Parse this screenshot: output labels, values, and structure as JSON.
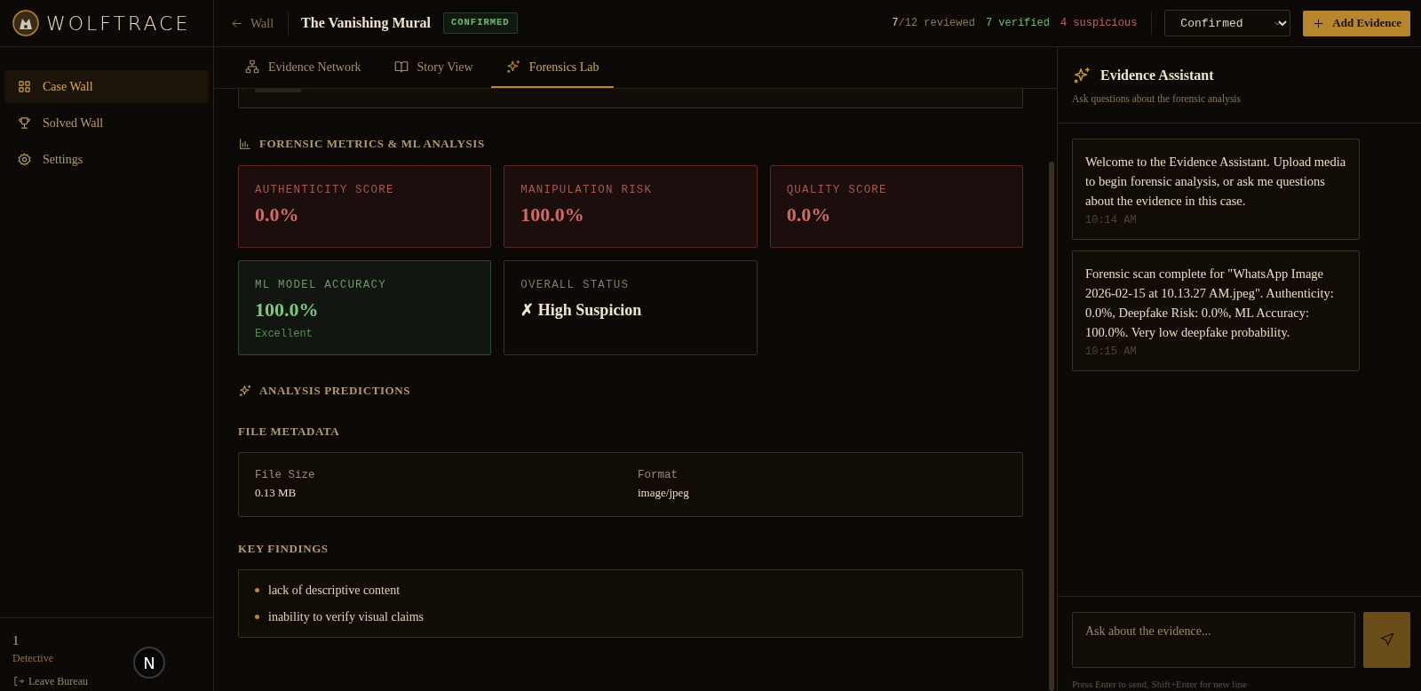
{
  "brand": {
    "name": "WOLFTRACE"
  },
  "sidebar": {
    "items": [
      {
        "label": "Case Wall",
        "selected": true
      },
      {
        "label": "Solved Wall",
        "selected": false
      },
      {
        "label": "Settings",
        "selected": false
      }
    ],
    "user": {
      "count": "1",
      "rank": "Detective",
      "logout": "Leave Bureau"
    }
  },
  "dev_badge": "N",
  "header": {
    "back": "Wall",
    "title": "The Vanishing Mural",
    "status_badge": "CONFIRMED",
    "stats": [
      {
        "kind": "progress",
        "strong": "7",
        "text": "/12 reviewed"
      },
      {
        "kind": "verified",
        "text": "7 verified"
      },
      {
        "kind": "suspicious",
        "text": "4 suspicious"
      }
    ],
    "status_select": "Confirmed",
    "add_button": "Add Evidence"
  },
  "tabs": [
    {
      "label": "Evidence Network",
      "selected": false
    },
    {
      "label": "Story View",
      "selected": false
    },
    {
      "label": "Forensics Lab",
      "selected": true
    }
  ],
  "metrics_section": {
    "title": "FORENSIC METRICS & ML ANALYSIS",
    "cards": [
      {
        "kind": "alert",
        "label": "AUTHENTICITY SCORE",
        "value": "0.0%"
      },
      {
        "kind": "alert",
        "label": "MANIPULATION RISK",
        "value": "100.0%"
      },
      {
        "kind": "alert",
        "label": "QUALITY SCORE",
        "value": "0.0%"
      },
      {
        "kind": "good",
        "label": "ML MODEL ACCURACY",
        "value": "100.0%",
        "note": "Excellent"
      },
      {
        "kind": "plain",
        "label": "OVERALL STATUS",
        "value": "✗ High Suspicion"
      }
    ]
  },
  "predictions_section": {
    "title": "ANALYSIS PREDICTIONS"
  },
  "file_metadata": {
    "title": "FILE METADATA",
    "fields": [
      {
        "label": "File Size",
        "value": "0.13 MB"
      },
      {
        "label": "Format",
        "value": "image/jpeg"
      }
    ]
  },
  "key_findings": {
    "title": "KEY FINDINGS",
    "items": [
      "lack of descriptive content",
      "inability to verify visual claims"
    ]
  },
  "assistant": {
    "title": "Evidence Assistant",
    "subtitle": "Ask questions about the forensic analysis",
    "messages": [
      {
        "text": "Welcome to the Evidence Assistant. Upload media to begin forensic analysis, or ask me questions about the evidence in this case.",
        "time": "10:14 AM"
      },
      {
        "text": "Forensic scan complete for \"WhatsApp Image 2026-02-15 at 10.13.27 AM.jpeg\". Authenticity: 0.0%, Deepfake Risk: 0.0%, ML Accuracy: 100.0%. Very low deepfake probability.",
        "time": "10:15 AM"
      }
    ],
    "input_placeholder": "Ask about the evidence...",
    "hint": "Press Enter to send, Shift+Enter for new line"
  }
}
